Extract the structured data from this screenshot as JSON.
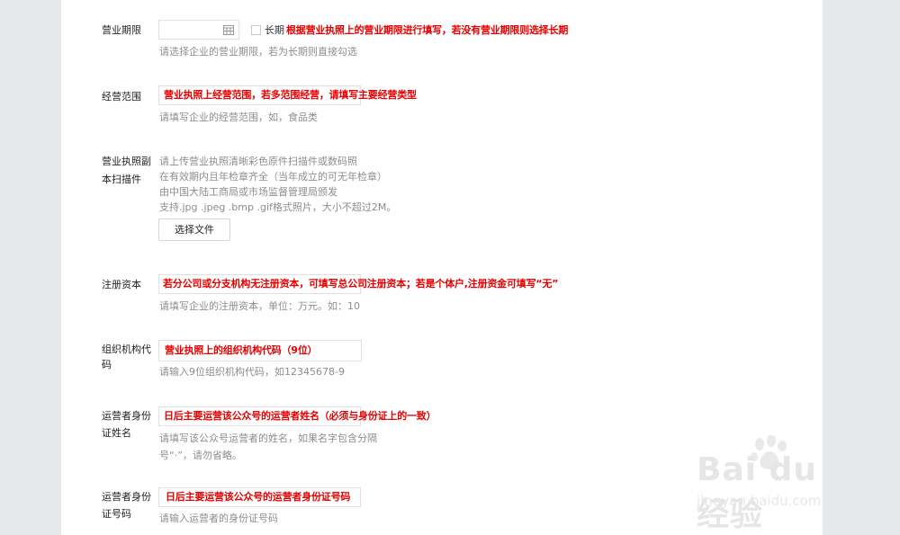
{
  "fields": {
    "period": {
      "label": "营业期限",
      "checkbox_label": "长期",
      "note": "根据营业执照上的营业期限进行填写，若没有营业期限则选择长期",
      "hint": "请选择企业的营业期限，若为长期则直接勾选"
    },
    "scope": {
      "label": "经营范围",
      "value": "营业执照上经营范围，若多范围经营，请填写主要经营类型",
      "hint": "请填写企业的经营范围，如，食品类"
    },
    "license": {
      "label_line1": "营业执照副",
      "label_line2": "本扫描件",
      "hint_lines": [
        "请上传营业执照清晰彩色原件扫描件或数码照",
        "在有效期内且年检章齐全（当年成立的可无年检章）",
        "由中国大陆工商局或市场监督管理局颁发",
        "支持.jpg .jpeg .bmp .gif格式照片，大小不超过2M。"
      ],
      "button": "选择文件"
    },
    "capital": {
      "label": "注册资本",
      "value": "若分公司或分支机构无注册资本，可填写总公司注册资本；若是个体户,注册资金可填写“无”",
      "hint": "请填写企业的注册资本，单位：万元。如：10"
    },
    "org_code": {
      "label_line1": "组织机构代",
      "label_line2": "码",
      "value": "营业执照上的组织机构代码（9位）",
      "hint": "请输入9位组织机构代码，如12345678-9"
    },
    "operator_name": {
      "label_line1": "运营者身份",
      "label_line2": "证姓名",
      "value": "日后主要运营该公众号的运营者姓名（必须与身份证上的一致）",
      "hint_line1": "请填写该公众号运营者的姓名，如果名字包含分隔",
      "hint_line2": "号“·”，请勿省略。"
    },
    "operator_id": {
      "label_line1": "运营者身份",
      "label_line2": "证号码",
      "value": "日后主要运营该公众号的运营者身份证号码",
      "hint": "请输入运营者的身份证号码"
    }
  },
  "watermark": {
    "brand": "Bai du 经验",
    "url": "jingyan.baidu.com"
  },
  "icons": {
    "calendar": "calendar-icon",
    "watermark": "baidu-paw-icon"
  },
  "colors": {
    "note_red": "#e60000",
    "hint_gray": "#8d8d8d",
    "page_bg": "#e7e8eb"
  }
}
